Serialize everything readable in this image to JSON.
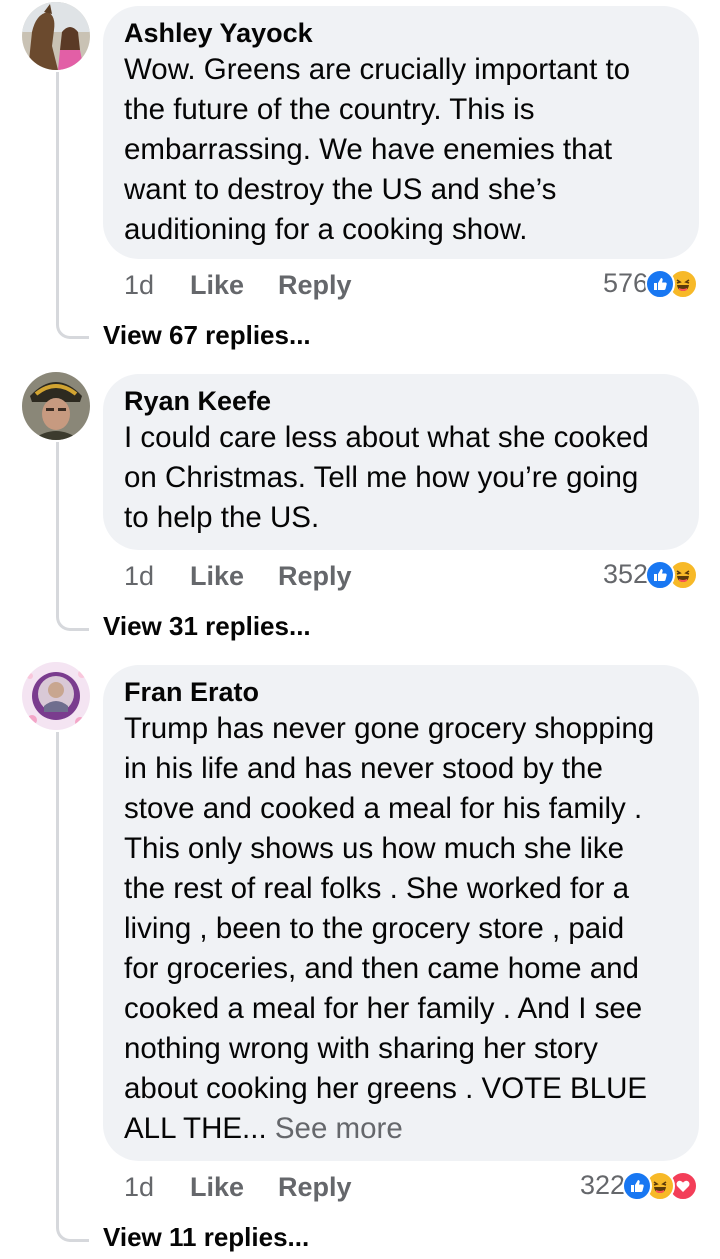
{
  "comments": [
    {
      "author": "Ashley Yayock",
      "text": "Wow. Greens are crucially important to\nthe future of the country. This is\nembarrassing. We have enemies that\nwant to destroy the US and she’s\nauditioning for a cooking show.",
      "age": "1d",
      "like_label": "Like",
      "reply_label": "Reply",
      "reaction_count": "576",
      "reactions": [
        "like-icon",
        "haha-icon"
      ],
      "view_replies": "View 67 replies..."
    },
    {
      "author": "Ryan Keefe",
      "text": "I could care less about what she cooked\non Christmas. Tell me how you’re going\nto help the US.",
      "age": "1d",
      "like_label": "Like",
      "reply_label": "Reply",
      "reaction_count": "352",
      "reactions": [
        "like-icon",
        "haha-icon"
      ],
      "view_replies": "View 31 replies..."
    },
    {
      "author": "Fran Erato",
      "text": "Trump has never gone grocery shopping\nin his life and has never stood by the\nstove and cooked a meal for his family .\nThis only shows us how much she like\nthe rest of real folks . She worked for a\nliving , been to the grocery store , paid\nfor groceries, and then came home and\ncooked a meal for her family . And I see\nnothing wrong with sharing her story\nabout cooking her greens . VOTE BLUE\nALL THE...",
      "see_more": "See more",
      "age": "1d",
      "like_label": "Like",
      "reply_label": "Reply",
      "reaction_count": "322",
      "reactions": [
        "like-icon",
        "haha-icon",
        "love-icon"
      ],
      "view_replies": "View 11 replies..."
    }
  ],
  "colors": {
    "bubble": "#f0f2f5",
    "secondary_text": "#65676b",
    "like_blue": "#1877f2",
    "haha_yellow": "#f7b928",
    "love_red": "#f33e58"
  }
}
